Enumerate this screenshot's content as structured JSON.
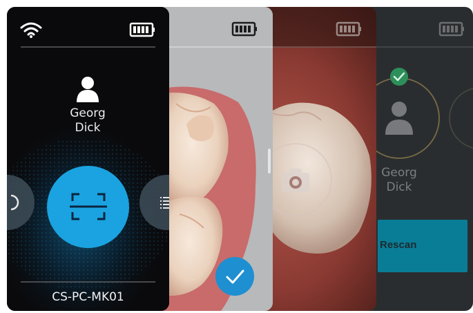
{
  "screens": {
    "home": {
      "patient_name_line1": "Georg",
      "patient_name_line2": "Dick",
      "device_id": "CS-PC-MK01",
      "icons": {
        "wifi": "wifi-icon",
        "battery": "battery-icon",
        "user": "user-icon",
        "scan": "scan-icon",
        "left_partial": "refresh-icon",
        "right_partial": "list-icon"
      },
      "colors": {
        "background": "#0a0a0c",
        "accent": "#1aa3e0"
      }
    },
    "scan_result": {
      "icons": {
        "battery": "battery-icon",
        "confirm": "check-icon"
      },
      "colors": {
        "confirm": "#1e8fd0"
      }
    },
    "photo": {
      "icons": {
        "battery": "battery-icon",
        "camera": "camera-icon"
      }
    },
    "patient_confirmed": {
      "patient_name_line1": "Georg",
      "patient_name_line2": "Dick",
      "rescan_label": "Rescan",
      "icons": {
        "battery": "battery-icon",
        "user": "user-icon",
        "confirmed": "check-badge-icon"
      },
      "colors": {
        "rescan": "#0a7d96",
        "ring": "#8a7a4a"
      }
    }
  }
}
